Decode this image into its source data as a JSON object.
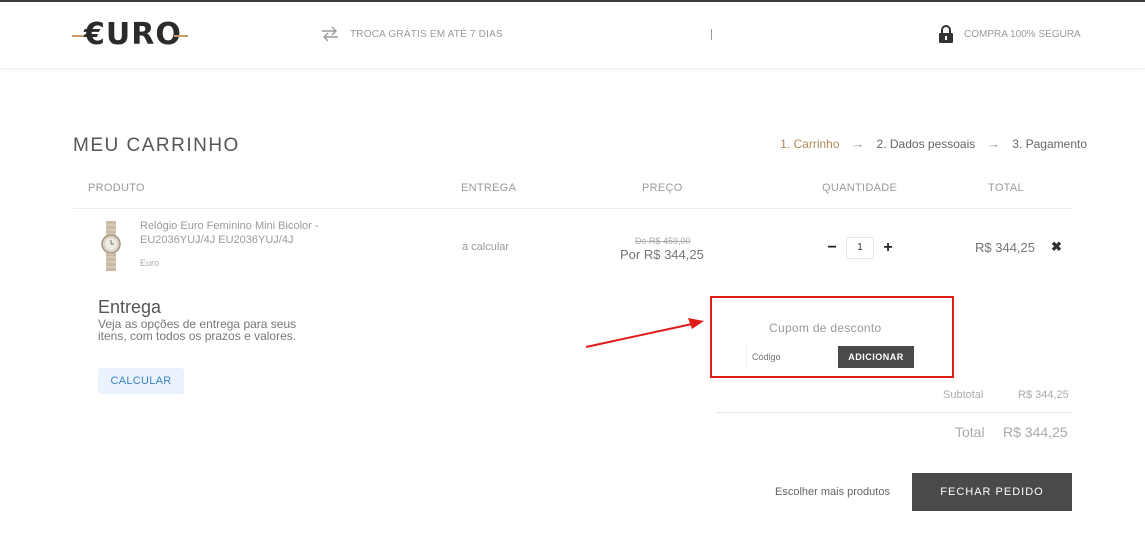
{
  "header": {
    "logo_text": "€URO",
    "trade_text": "TROCA GRÁTIS EM ATÉ 7 DIAS",
    "secure_text": "COMPRA 100% SEGURA",
    "separator": "|"
  },
  "page": {
    "title": "MEU CARRINHO",
    "steps": [
      "1. Carrinho",
      "2. Dados pessoais",
      "3. Pagamento"
    ],
    "step_arrow": "→"
  },
  "table": {
    "columns": [
      "PRODUTO",
      "ENTREGA",
      "PREÇO",
      "QUANTIDADE",
      "TOTAL"
    ],
    "item": {
      "name": "Relógio Euro Feminino Mini Bicolor - EU2036YUJ/4J EU2036YUJ/4J",
      "brand": "Euro",
      "delivery": "a calcular",
      "old_price": "De R$ 459,00",
      "price": "Por R$ 344,25",
      "quantity": "1",
      "total": "R$ 344,25",
      "minus": "−",
      "plus": "+",
      "remove": "✖"
    }
  },
  "shipping": {
    "title": "Entrega",
    "description": "Veja as opções de entrega para seus itens, com todos os prazos e valores.",
    "button": "CALCULAR"
  },
  "coupon": {
    "title": "Cupom de desconto",
    "placeholder": "Código",
    "button": "ADICIONAR",
    "highlight_color": "#e11a1a"
  },
  "summary": {
    "subtotal_label": "Subtotal",
    "subtotal_value": "R$ 344,25",
    "total_label": "Total",
    "total_value": "R$ 344,25"
  },
  "actions": {
    "more_products": "Escolher mais produtos",
    "checkout": "FECHAR PEDIDO"
  }
}
